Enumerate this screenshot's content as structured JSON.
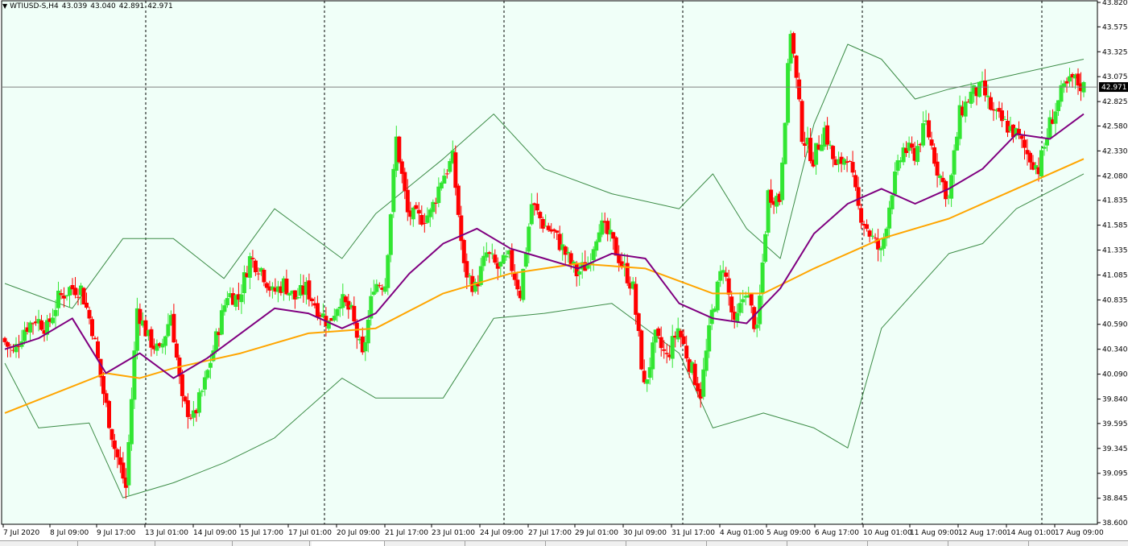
{
  "header": {
    "symbol": "WTIUSD-S,H4",
    "open": "43.039",
    "high": "43.040",
    "low": "42.891",
    "close": "42.971"
  },
  "colors": {
    "background": "#f0fff8",
    "bull": "#32e632",
    "bear": "#ff0000",
    "bands": "#3c8c46",
    "ma_fast": "#800080",
    "ma_slow": "#ffa500",
    "grid": "#000000"
  },
  "chart_data": {
    "type": "candlestick",
    "ylim": [
      38.6,
      43.82
    ],
    "y_ticks": [
      "43.820",
      "43.575",
      "43.325",
      "43.075",
      "42.825",
      "42.580",
      "42.330",
      "42.080",
      "41.835",
      "41.585",
      "41.335",
      "41.085",
      "40.835",
      "40.590",
      "40.340",
      "40.090",
      "39.840",
      "39.595",
      "39.345",
      "39.095",
      "38.845",
      "38.600"
    ],
    "x_labels": [
      "7 Jul 2020",
      "8 Jul 09:00",
      "9 Jul 17:00",
      "13 Jul 01:00",
      "14 Jul 09:00",
      "15 Jul 17:00",
      "17 Jul 01:00",
      "20 Jul 09:00",
      "21 Jul 17:00",
      "23 Jul 01:00",
      "24 Jul 09:00",
      "27 Jul 17:00",
      "29 Jul 01:00",
      "30 Jul 09:00",
      "31 Jul 17:00",
      "4 Aug 01:00",
      "5 Aug 09:00",
      "6 Aug 17:00",
      "10 Aug 01:00",
      "11 Aug 09:00",
      "12 Aug 17:00",
      "14 Aug 01:00",
      "17 Aug 09:00"
    ],
    "current_price": "42.971",
    "anchors": [
      40.45,
      40.3,
      40.55,
      40.65,
      40.55,
      40.85,
      40.95,
      40.95,
      40.55,
      39.9,
      39.35,
      38.95,
      40.75,
      40.45,
      40.3,
      40.7,
      39.8,
      39.65,
      40.0,
      40.45,
      40.9,
      40.85,
      41.25,
      41.15,
      40.9,
      41.0,
      40.85,
      40.95,
      40.75,
      40.6,
      40.85,
      40.7,
      40.25,
      41.0,
      41.0,
      42.45,
      41.7,
      41.65,
      41.7,
      42.05,
      42.25,
      41.15,
      40.95,
      41.3,
      41.15,
      41.25,
      40.9,
      41.8,
      41.6,
      41.5,
      41.3,
      41.1,
      41.2,
      41.6,
      41.45,
      41.2,
      40.95,
      39.95,
      40.45,
      40.25,
      40.55,
      40.2,
      39.9,
      40.7,
      41.2,
      40.55,
      40.95,
      40.5,
      41.9,
      41.85,
      43.55,
      42.5,
      42.25,
      42.55,
      42.15,
      42.3,
      41.75,
      41.5,
      41.3,
      41.95,
      42.35,
      42.3,
      42.6,
      42.15,
      41.85,
      42.7,
      42.9,
      42.95,
      42.7,
      42.6,
      42.5,
      42.3,
      42.15,
      42.6,
      42.9,
      43.05,
      42.97
    ],
    "ma_fast_points": [
      [
        0,
        40.34
      ],
      [
        4,
        40.45
      ],
      [
        8,
        40.65
      ],
      [
        12,
        40.1
      ],
      [
        16,
        40.3
      ],
      [
        20,
        40.05
      ],
      [
        24,
        40.25
      ],
      [
        28,
        40.5
      ],
      [
        32,
        40.75
      ],
      [
        36,
        40.7
      ],
      [
        40,
        40.55
      ],
      [
        44,
        40.7
      ],
      [
        48,
        41.1
      ],
      [
        52,
        41.4
      ],
      [
        56,
        41.55
      ],
      [
        60,
        41.35
      ],
      [
        64,
        41.25
      ],
      [
        68,
        41.15
      ],
      [
        72,
        41.3
      ],
      [
        76,
        41.25
      ],
      [
        80,
        40.8
      ],
      [
        84,
        40.65
      ],
      [
        88,
        40.6
      ],
      [
        92,
        40.95
      ],
      [
        96,
        41.5
      ],
      [
        100,
        41.8
      ],
      [
        104,
        41.95
      ],
      [
        108,
        41.8
      ],
      [
        112,
        41.95
      ],
      [
        116,
        42.15
      ],
      [
        120,
        42.5
      ],
      [
        124,
        42.45
      ],
      [
        128,
        42.7
      ]
    ],
    "ma_slow_points": [
      [
        0,
        39.7
      ],
      [
        12,
        40.1
      ],
      [
        16,
        40.05
      ],
      [
        20,
        40.15
      ],
      [
        28,
        40.3
      ],
      [
        36,
        40.5
      ],
      [
        44,
        40.55
      ],
      [
        52,
        40.9
      ],
      [
        60,
        41.1
      ],
      [
        68,
        41.2
      ],
      [
        76,
        41.15
      ],
      [
        84,
        40.9
      ],
      [
        90,
        40.9
      ],
      [
        96,
        41.15
      ],
      [
        104,
        41.45
      ],
      [
        112,
        41.65
      ],
      [
        120,
        41.95
      ],
      [
        128,
        42.25
      ]
    ],
    "bb_upper_points": [
      [
        0,
        41.0
      ],
      [
        8,
        40.75
      ],
      [
        14,
        41.45
      ],
      [
        20,
        41.45
      ],
      [
        26,
        41.05
      ],
      [
        32,
        41.75
      ],
      [
        40,
        41.25
      ],
      [
        44,
        41.7
      ],
      [
        52,
        42.25
      ],
      [
        58,
        42.7
      ],
      [
        64,
        42.15
      ],
      [
        72,
        41.9
      ],
      [
        80,
        41.75
      ],
      [
        84,
        42.1
      ],
      [
        88,
        41.55
      ],
      [
        92,
        41.25
      ],
      [
        96,
        42.6
      ],
      [
        100,
        43.4
      ],
      [
        104,
        43.25
      ],
      [
        108,
        42.85
      ],
      [
        112,
        42.95
      ],
      [
        120,
        43.1
      ],
      [
        128,
        43.25
      ]
    ],
    "bb_lower_points": [
      [
        0,
        40.2
      ],
      [
        4,
        39.55
      ],
      [
        10,
        39.6
      ],
      [
        14,
        38.85
      ],
      [
        20,
        39.0
      ],
      [
        26,
        39.2
      ],
      [
        32,
        39.45
      ],
      [
        40,
        40.05
      ],
      [
        44,
        39.85
      ],
      [
        52,
        39.85
      ],
      [
        58,
        40.65
      ],
      [
        64,
        40.7
      ],
      [
        72,
        40.8
      ],
      [
        80,
        40.3
      ],
      [
        84,
        39.55
      ],
      [
        90,
        39.7
      ],
      [
        96,
        39.55
      ],
      [
        100,
        39.35
      ],
      [
        104,
        40.55
      ],
      [
        112,
        41.3
      ],
      [
        116,
        41.4
      ],
      [
        120,
        41.75
      ],
      [
        128,
        42.1
      ]
    ]
  }
}
